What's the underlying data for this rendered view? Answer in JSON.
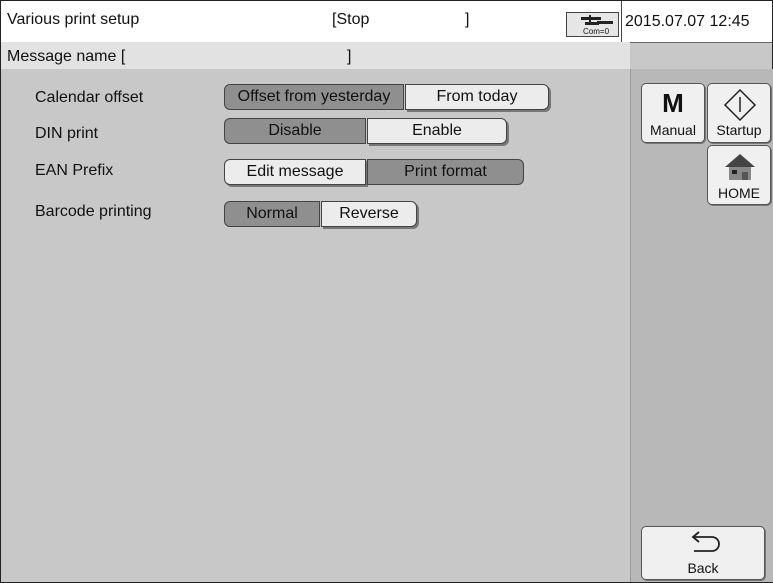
{
  "header": {
    "title": "Various print setup",
    "status_open": "[Stop",
    "status_close": "]",
    "comm_label": "Com=0",
    "datetime": "2015.07.07 12:45"
  },
  "message": {
    "label": "Message name [",
    "close": "]"
  },
  "rows": [
    {
      "label": "Calendar offset",
      "options": [
        "Offset from yesterday",
        "From today"
      ],
      "selected": 0
    },
    {
      "label": "DIN print",
      "options": [
        "Disable",
        "Enable"
      ],
      "selected": 0
    },
    {
      "label": "EAN Prefix",
      "options": [
        "Edit message",
        "Print format"
      ],
      "selected": 1
    },
    {
      "label": "Barcode printing",
      "options": [
        "Normal",
        "Reverse"
      ],
      "selected": 0
    }
  ],
  "side": {
    "manual_glyph": "M",
    "manual_label": "Manual",
    "startup_label": "Startup",
    "home_label": "HOME",
    "back_label": "Back"
  }
}
